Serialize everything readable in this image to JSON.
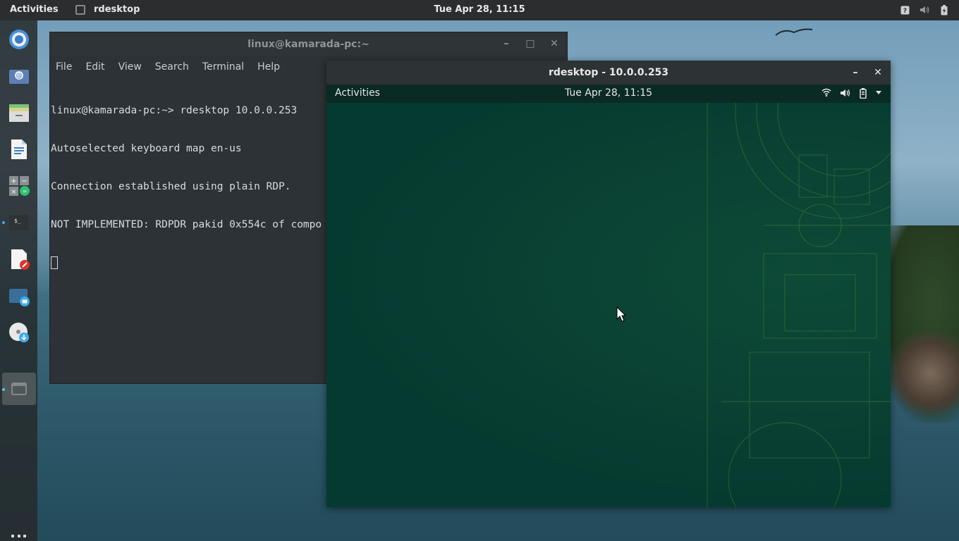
{
  "topbar": {
    "activities_label": "Activities",
    "app_name": "rdesktop",
    "clock": "Tue Apr 28, 11:15",
    "tray_icons": [
      "help-icon",
      "volume-icon",
      "battery-icon"
    ]
  },
  "dock": {
    "items": [
      "chromium-icon",
      "mail-icon",
      "files-icon",
      "document-icon",
      "calculator-icon",
      "terminal-icon",
      "text-editor-icon",
      "screenshot-icon",
      "disk-icon",
      "window-icon"
    ],
    "show_apps_icon": "apps-grid-icon"
  },
  "terminal": {
    "title": "linux@kamarada-pc:~",
    "menu": [
      "File",
      "Edit",
      "View",
      "Search",
      "Terminal",
      "Help"
    ],
    "lines": [
      "linux@kamarada-pc:~> rdesktop 10.0.0.253",
      "Autoselected keyboard map en-us",
      "Connection established using plain RDP.",
      "NOT IMPLEMENTED: RDPDR pakid 0x554c of compo"
    ]
  },
  "rdp": {
    "title": "rdesktop - 10.0.0.253",
    "remote_activities": "Activities",
    "remote_clock": "Tue Apr 28, 11:15",
    "remote_tray": [
      "wifi-icon",
      "volume-icon",
      "battery-icon",
      "menu-arrow-icon"
    ]
  },
  "colors": {
    "remote_desktop_bg": "#04382f",
    "accent": "#3daee9"
  }
}
